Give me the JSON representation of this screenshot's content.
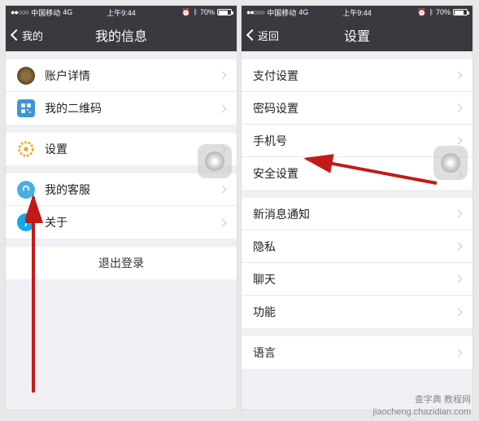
{
  "status": {
    "carrier": "中国移动",
    "network": "4G",
    "time": "上午9:44",
    "battery": "70%"
  },
  "left": {
    "backLabel": "我的",
    "title": "我的信息",
    "rows": {
      "account": "账户详情",
      "qr": "我的二维码",
      "settings": "设置",
      "service": "我的客服",
      "about": "关于"
    },
    "logout": "退出登录"
  },
  "right": {
    "backLabel": "返回",
    "title": "设置",
    "rows": {
      "pay": "支付设置",
      "pwd": "密码设置",
      "phone": "手机号",
      "security": "安全设置",
      "notify": "新消息通知",
      "privacy": "隐私",
      "chat": "聊天",
      "func": "功能",
      "lang": "语言"
    }
  },
  "watermark": {
    "line1": "查字典 教程网",
    "line2": "jiaocheng.chazidian.com"
  }
}
